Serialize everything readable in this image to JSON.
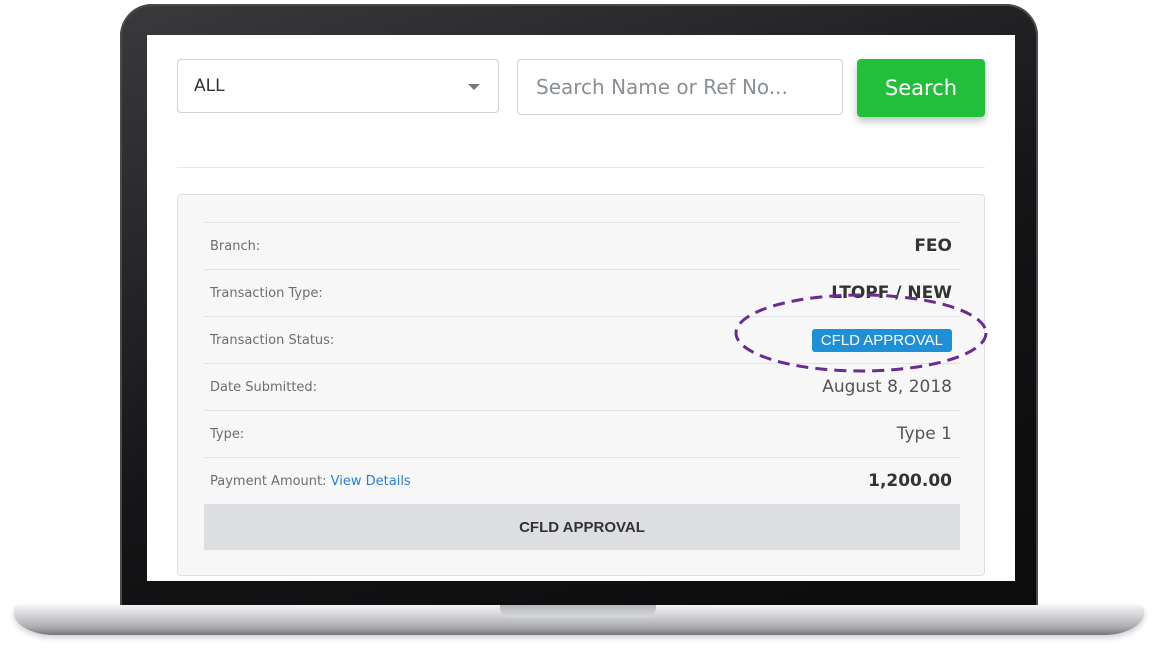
{
  "toolbar": {
    "filter_value": "ALL",
    "search_placeholder": "Search Name or Ref No...",
    "search_button_label": "Search",
    "search_button_color": "#22c03a"
  },
  "transaction": {
    "rows": [
      {
        "label": "Branch:",
        "value": "FEO"
      },
      {
        "label": "Transaction Type:",
        "value": "LTOPF / NEW"
      },
      {
        "label": "Transaction Status:",
        "value": "CFLD APPROVAL"
      },
      {
        "label": "Date Submitted:",
        "value": "August 8, 2018"
      },
      {
        "label": "Type:",
        "value": "Type 1"
      },
      {
        "label": "Payment Amount:",
        "link": "View Details",
        "value": "1,200.00"
      }
    ],
    "status_badge_color": "#1f8fd6",
    "footer_status": "CFLD APPROVAL"
  },
  "annotation_color": "#6a2c91"
}
